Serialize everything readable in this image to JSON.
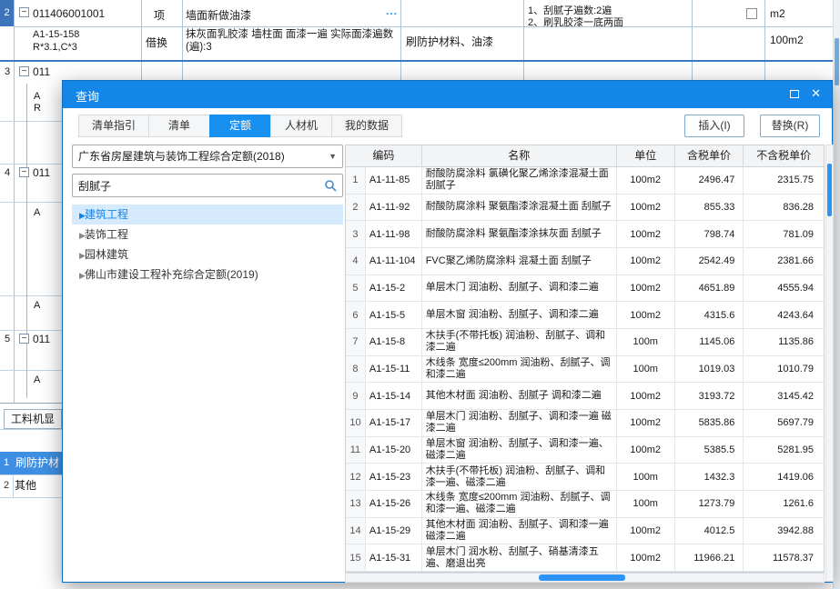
{
  "icons": {
    "minus": "−",
    "close": "✕",
    "caret": "▼",
    "arrow": "▶",
    "more": "..."
  },
  "bg": {
    "row2": {
      "num": "2",
      "code": "011406001001",
      "type": "项",
      "name": "墙面新做油漆",
      "feature1": "1、刮腻子遍数:2遍",
      "feature2": "2、刷乳胶漆一底两面",
      "unit": "m2"
    },
    "row2sub": {
      "code1": "A1-15-158",
      "code2": "R*3.1,C*3",
      "type": "借换",
      "name": "抹灰面乳胶漆 墙柱面 面漆一遍 实际面漆遍数(遍):3",
      "content": "刷防护材料、油漆",
      "unit": "100m2"
    },
    "row3": {
      "num": "3",
      "code": "011"
    },
    "row4": {
      "num": "4",
      "code": "011"
    },
    "row5": {
      "num": "5",
      "code": "011"
    },
    "partials": [
      "A",
      "R",
      "A",
      "A",
      "A"
    ],
    "bottom_tab": "工料机显",
    "bottom_rows": [
      {
        "num": "1",
        "text": "刷防护材"
      },
      {
        "num": "2",
        "text": "其他"
      }
    ]
  },
  "dialog": {
    "title": "查询",
    "tabs": [
      {
        "label": "清单指引"
      },
      {
        "label": "清单"
      },
      {
        "label": "定额"
      },
      {
        "label": "人材机"
      },
      {
        "label": "我的数据"
      }
    ],
    "insert": "插入(I)",
    "replace": "替换(R)",
    "left": {
      "quota": "广东省房屋建筑与装饰工程综合定额(2018)",
      "search": "刮腻子",
      "tree": [
        {
          "label": "建筑工程"
        },
        {
          "label": "装饰工程"
        },
        {
          "label": "园林建筑"
        },
        {
          "label": "佛山市建设工程补充综合定额(2019)"
        }
      ]
    },
    "table": {
      "h_code": "编码",
      "h_name": "名称",
      "h_unit": "单位",
      "h_tax": "含税单价",
      "h_notax": "不含税单价",
      "rows": [
        {
          "num": "1",
          "code": "A1-11-85",
          "name": "耐酸防腐涂料 氯磺化聚乙烯涂漆混凝土面 刮腻子",
          "unit": "100m2",
          "tax": "2496.47",
          "notax": "2315.75"
        },
        {
          "num": "2",
          "code": "A1-11-92",
          "name": "耐酸防腐涂料 聚氨酯漆涂混凝土面 刮腻子",
          "unit": "100m2",
          "tax": "855.33",
          "notax": "836.28"
        },
        {
          "num": "3",
          "code": "A1-11-98",
          "name": "耐酸防腐涂料 聚氨酯漆涂抹灰面 刮腻子",
          "unit": "100m2",
          "tax": "798.74",
          "notax": "781.09"
        },
        {
          "num": "4",
          "code": "A1-11-104",
          "name": "FVC聚乙烯防腐涂料 混凝土面 刮腻子",
          "unit": "100m2",
          "tax": "2542.49",
          "notax": "2381.66"
        },
        {
          "num": "5",
          "code": "A1-15-2",
          "name": "单层木门 润油粉、刮腻子、调和漆二遍",
          "unit": "100m2",
          "tax": "4651.89",
          "notax": "4555.94"
        },
        {
          "num": "6",
          "code": "A1-15-5",
          "name": "单层木窗 润油粉、刮腻子、调和漆二遍",
          "unit": "100m2",
          "tax": "4315.6",
          "notax": "4243.64"
        },
        {
          "num": "7",
          "code": "A1-15-8",
          "name": "木扶手(不带托板) 润油粉、刮腻子、调和漆二遍",
          "unit": "100m",
          "tax": "1145.06",
          "notax": "1135.86"
        },
        {
          "num": "8",
          "code": "A1-15-11",
          "name": "木线条 宽度≤200mm 润油粉、刮腻子、调和漆二遍",
          "unit": "100m",
          "tax": "1019.03",
          "notax": "1010.79"
        },
        {
          "num": "9",
          "code": "A1-15-14",
          "name": "其他木材面 润油粉、刮腻子 调和漆二遍",
          "unit": "100m2",
          "tax": "3193.72",
          "notax": "3145.42"
        },
        {
          "num": "10",
          "code": "A1-15-17",
          "name": "单层木门 润油粉、刮腻子、调和漆一遍 磁漆二遍",
          "unit": "100m2",
          "tax": "5835.86",
          "notax": "5697.79"
        },
        {
          "num": "11",
          "code": "A1-15-20",
          "name": "单层木窗 润油粉、刮腻子、调和漆一遍、磁漆二遍",
          "unit": "100m2",
          "tax": "5385.5",
          "notax": "5281.95"
        },
        {
          "num": "12",
          "code": "A1-15-23",
          "name": "木扶手(不带托板) 润油粉、刮腻子、调和漆一遍、磁漆二遍",
          "unit": "100m",
          "tax": "1432.3",
          "notax": "1419.06"
        },
        {
          "num": "13",
          "code": "A1-15-26",
          "name": "木线条 宽度≤200mm 润油粉、刮腻子、调和漆一遍、磁漆二遍",
          "unit": "100m",
          "tax": "1273.79",
          "notax": "1261.6"
        },
        {
          "num": "14",
          "code": "A1-15-29",
          "name": "其他木材面 润油粉、刮腻子、调和漆一遍 磁漆二遍",
          "unit": "100m2",
          "tax": "4012.5",
          "notax": "3942.88"
        },
        {
          "num": "15",
          "code": "A1-15-31",
          "name": "单层木门 润水粉、刮腻子、硝基清漆五遍、磨退出亮",
          "unit": "100m2",
          "tax": "11966.21",
          "notax": "11578.37"
        }
      ]
    }
  },
  "colors": {
    "accent": "#1486e8",
    "active_tab": "#1890f0",
    "selection": "#3e8fe3"
  }
}
